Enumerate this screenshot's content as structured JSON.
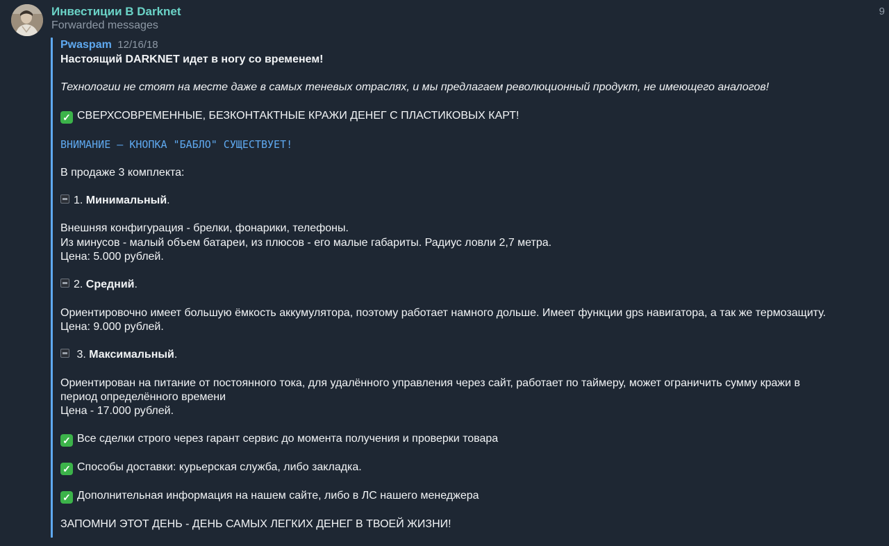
{
  "header": {
    "channel_name": "Инвестиции В Darknet",
    "forwarded_label": "Forwarded messages",
    "time_stub": "9"
  },
  "forwarded": {
    "author": "Pwaspam",
    "date": "12/16/18",
    "title": "Настоящий DARKNET идет в ногу со временем!",
    "intro": "Технологии не стоят на месте даже в самых теневых отраслях, и мы предлагаем революционный продукт, не имеющего аналогов!",
    "feature": "СВЕРХСОВРЕМЕННЫЕ,  БЕЗКОНТАКТНЫЕ КРАЖИ ДЕНЕГ С ПЛАСТИКОВЫХ КАРТ!",
    "attention": "ВНИМАНИЕ — КНОПКА \"БАБЛО\" СУЩЕСТВУЕТ!",
    "sale_intro": "В продаже 3 комплекта:",
    "kits": [
      {
        "prefix": "1. ",
        "name": "Минимальный",
        "suffix": ".",
        "lines": [
          "Внешняя конфигурация -  брелки, фонарики, телефоны.",
          "Из минусов - малый объем батареи, из плюсов -  его малые габариты. Радиус ловли 2,7 метра.",
          "Цена: 5.000 рублей."
        ]
      },
      {
        "prefix": "2. ",
        "name": "Средний",
        "suffix": ".",
        "lines": [
          "Ориентировочно имеет большую ёмкость аккумулятора, поэтому работает намного дольше. Имеет функции gps навигатора, а так же термозащиту.",
          "Цена: 9.000 рублей."
        ]
      },
      {
        "prefix": " 3. ",
        "name": "Максимальный",
        "suffix": ".",
        "lines": [
          "Ориентирован на питание от постоянного тока, для удалённого управления через сайт, работает по таймеру, может ограничить сумму кражи в",
          "период определённого времени",
          "Цена - 17.000 рублей."
        ]
      }
    ],
    "checks": [
      "Все сделки строго через гарант сервис до момента получения и проверки товара",
      "Способы доставки: курьерская служба, либо закладка.",
      "Дополнительная информация на нашем сайте, либо в ЛС нашего менеджера"
    ],
    "closing": "ЗАПОМНИ ЭТОТ ДЕНЬ - ДЕНЬ САМЫХ ЛЕГКИХ ДЕНЕГ В ТВОЕЙ ЖИЗНИ!"
  },
  "icons": {
    "check": "check-mark-button-icon",
    "device": "device-icon"
  },
  "colors": {
    "background": "#1e2733",
    "channel_name": "#6bd3c7",
    "author": "#5fa9f0",
    "accent_bar": "#5fa9f0",
    "muted": "#8e99a6",
    "check": "#3cb34a"
  }
}
